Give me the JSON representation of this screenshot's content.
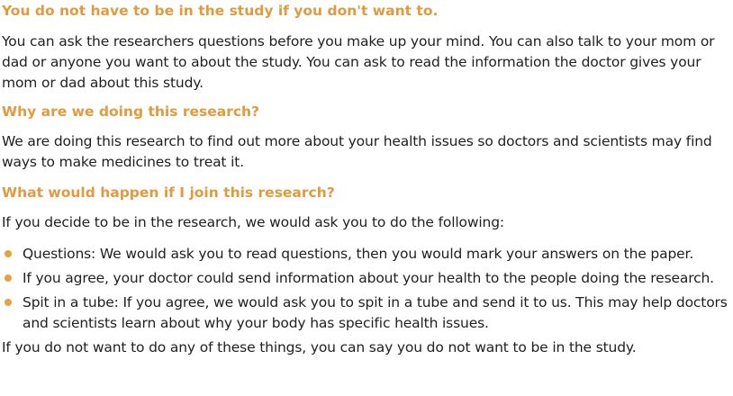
{
  "sections": [
    {
      "heading": "You do not have to be in the study if you don't want to.",
      "body": "You can ask the researchers questions before you make up your mind. You can also talk to your mom or dad or anyone you want to about the study. You can ask to read the information the doctor gives your mom or dad about this study."
    },
    {
      "heading": "Why are we doing this research?",
      "body": "We are doing this research to find out more about your health issues so doctors and scientists may find ways to make medicines to treat it."
    },
    {
      "heading": "What would happen if I join this research?",
      "body": "If you decide to be in the research, we would ask you to do the following:"
    }
  ],
  "bullets": [
    "Questions: We would ask you to read questions, then you would mark your answers on the paper.",
    "If you agree, your doctor could send information about your health to the people doing the research.",
    "Spit in a tube: If you agree, we would ask you to spit in a tube and send it to us. This may help doctors and scientists learn about why your body has specific health issues."
  ],
  "closing": "If you do not want to do any of these things, you can say you do not want to be in the study.",
  "colors": {
    "heading": "#e29a3f",
    "bullet": "#e8a33c",
    "text": "#1f1f1f"
  }
}
